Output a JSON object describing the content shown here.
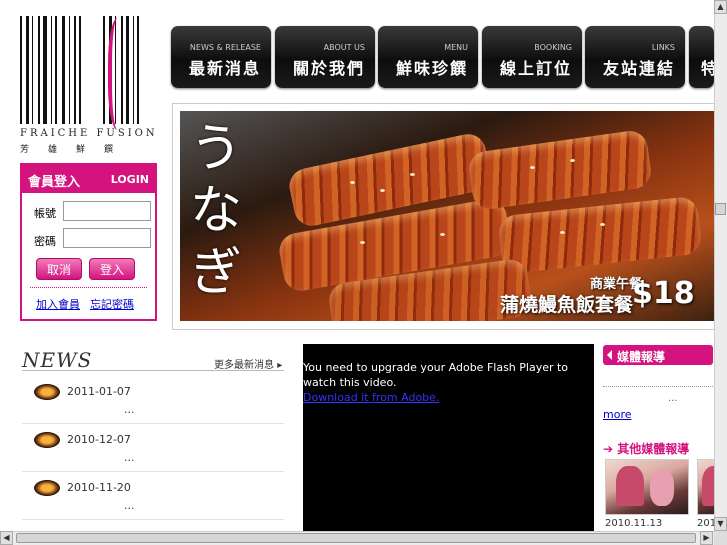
{
  "logo": {
    "brand": "FRAICHE FUSION",
    "sub": "芳雄鮮饌"
  },
  "nav": [
    {
      "en": "NEWS & RELEASE",
      "zh": "最新消息"
    },
    {
      "en": "ABOUT US",
      "zh": "關於我們"
    },
    {
      "en": "MENU",
      "zh": "鮮味珍饌"
    },
    {
      "en": "BOOKING",
      "zh": "線上訂位"
    },
    {
      "en": "LINKS",
      "zh": "友站連結"
    },
    {
      "en": "",
      "zh": "特"
    }
  ],
  "banner": {
    "kana": "うなぎ",
    "promo_line1": "商業午餐",
    "promo_line2": "蒲燒鰻魚飯套餐",
    "price": "$18"
  },
  "login": {
    "title_zh": "會員登入",
    "title_en": "LOGIN",
    "user_label": "帳號",
    "pass_label": "密碼",
    "cancel": "取消",
    "submit": "登入",
    "link1": "加入會員",
    "link2": "忘記密碼"
  },
  "news": {
    "title": "NEWS",
    "more": "更多最新消息",
    "items": [
      {
        "date": "2011-01-07",
        "text": "..."
      },
      {
        "date": "2010-12-07",
        "text": "..."
      },
      {
        "date": "2010-11-20",
        "text": "..."
      }
    ]
  },
  "flash": {
    "message": "You need to upgrade your Adobe Flash Player to watch this video.",
    "link": "Download it from Adobe."
  },
  "media": {
    "title": "媒體報導",
    "ellipsis": "...",
    "more": "more",
    "other_title": "其他媒體報導",
    "thumbs": [
      {
        "date": "2010.11.13"
      },
      {
        "date": "201"
      }
    ]
  },
  "colors": {
    "accent": "#d4137f",
    "nav_bg": "#111111"
  }
}
